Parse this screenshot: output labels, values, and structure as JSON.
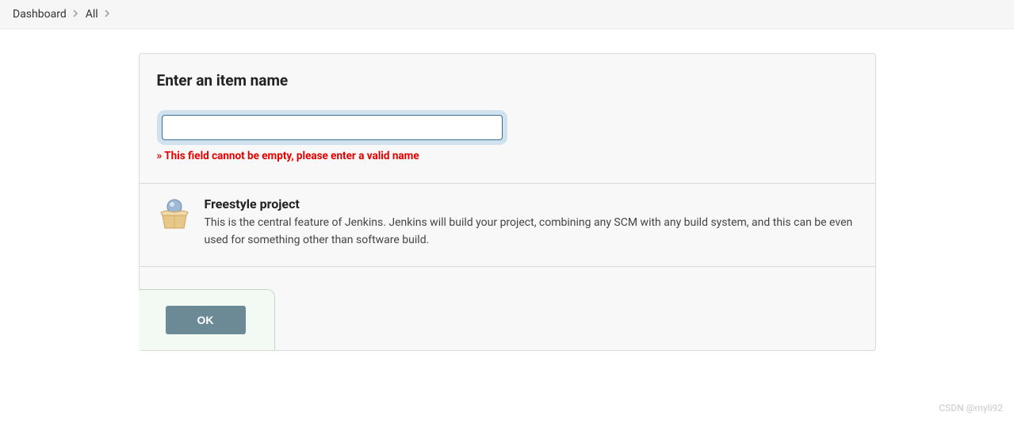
{
  "breadcrumb": {
    "items": [
      "Dashboard",
      "All"
    ]
  },
  "form": {
    "title": "Enter an item name",
    "input_value": "",
    "input_placeholder": "",
    "error": "» This field cannot be empty, please enter a valid name"
  },
  "project_type": {
    "icon": "freestyle-project-icon",
    "title": "Freestyle project",
    "description": "This is the central feature of Jenkins. Jenkins will build your project, combining any SCM with any build system, and this can be even used for something other than software build."
  },
  "footer": {
    "ok_label": "OK"
  },
  "watermark": "CSDN @myli92"
}
